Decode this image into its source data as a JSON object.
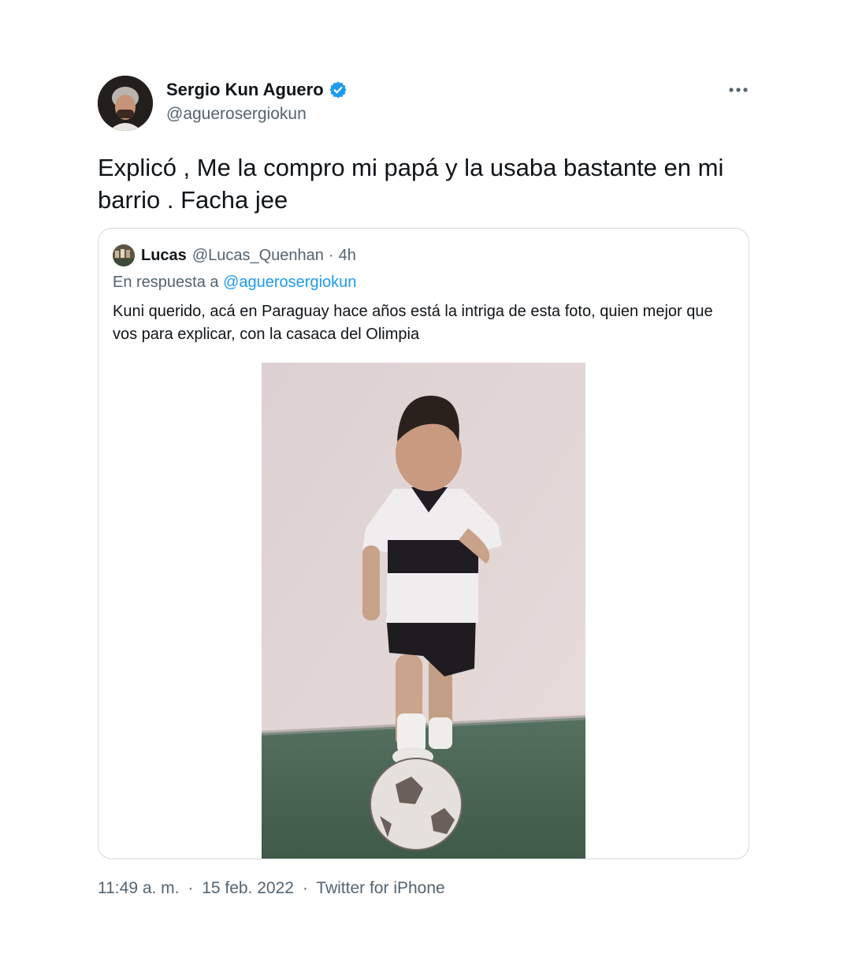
{
  "tweet": {
    "author_name": "Sergio Kun Aguero",
    "author_handle": "@aguerosergiokun",
    "verified": true,
    "text": "Explicó , Me la compro mi papá y la usaba bastante en mi barrio . Facha jee",
    "time": "11:49 a. m.",
    "date": "15 feb. 2022",
    "source": "Twitter for iPhone",
    "separator": "·"
  },
  "quoted": {
    "author_name": "Lucas",
    "author_handle": "@Lucas_Quenhan",
    "separator": "·",
    "time_ago": "4h",
    "reply_prefix": "En respuesta a",
    "reply_to": "@aguerosergiokun",
    "text": "Kuni querido, acá en Paraguay hace años está la intriga de esta foto, quien mejor que vos para explicar, con la casaca del Olimpia"
  },
  "colors": {
    "text_primary": "#0f1419",
    "text_secondary": "#536471",
    "link": "#1d9bf0",
    "verified_badge": "#1d9bf0",
    "card_border": "#cfd9de"
  },
  "icons": {
    "verified": "verified-badge-icon",
    "more": "more-options-icon"
  }
}
